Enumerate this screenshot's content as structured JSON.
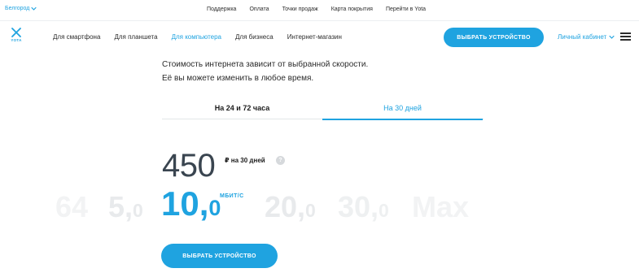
{
  "header": {
    "city": "Белгород",
    "top_links": [
      "Поддержка",
      "Оплата",
      "Точки продаж",
      "Карта покрытия",
      "Перейти в Yota"
    ]
  },
  "nav": {
    "logo_text": "YOTA",
    "items": [
      {
        "label": "Для смартфона",
        "active": false
      },
      {
        "label": "Для планшета",
        "active": false
      },
      {
        "label": "Для компьютера",
        "active": true
      },
      {
        "label": "Для бизнеса",
        "active": false
      },
      {
        "label": "Интернет-магазин",
        "active": false
      }
    ],
    "select_device_label": "ВЫБРАТЬ УСТРОЙСТВО",
    "cabinet_label": "Личный кабинет"
  },
  "main": {
    "intro_line1": "Стоимость интернета зависит от выбранной скорости.",
    "intro_line2": "Её вы можете изменить в любое время.",
    "tabs": [
      {
        "label": "На 24 и 72 часа",
        "active": false
      },
      {
        "label": "На 30 дней",
        "active": true
      }
    ],
    "price": "450",
    "price_unit": "₽ на 30 дней",
    "help_label": "?",
    "speeds": [
      {
        "int": "64",
        "dec": ""
      },
      {
        "int": "5,",
        "dec": "0"
      },
      {
        "int": "10,",
        "dec": "0"
      },
      {
        "int": "20,",
        "dec": "0"
      },
      {
        "int": "30,",
        "dec": "0"
      },
      {
        "int": "Max",
        "dec": ""
      }
    ],
    "selected_speed_index": 2,
    "speed_unit": "МБИТ/С",
    "select_device_label": "ВЫБРАТЬ УСТРОЙСТВО"
  },
  "colors": {
    "accent": "#1fa3e0",
    "text": "#1b1b1b",
    "price": "#3a4550",
    "inactive_speed": "#e8eaec"
  },
  "icons": {
    "city_dropdown": "chevron-down-icon",
    "cabinet_dropdown": "chevron-down-icon",
    "menu": "hamburger-menu-icon",
    "logo": "yota-logo-icon",
    "help": "question-icon"
  }
}
